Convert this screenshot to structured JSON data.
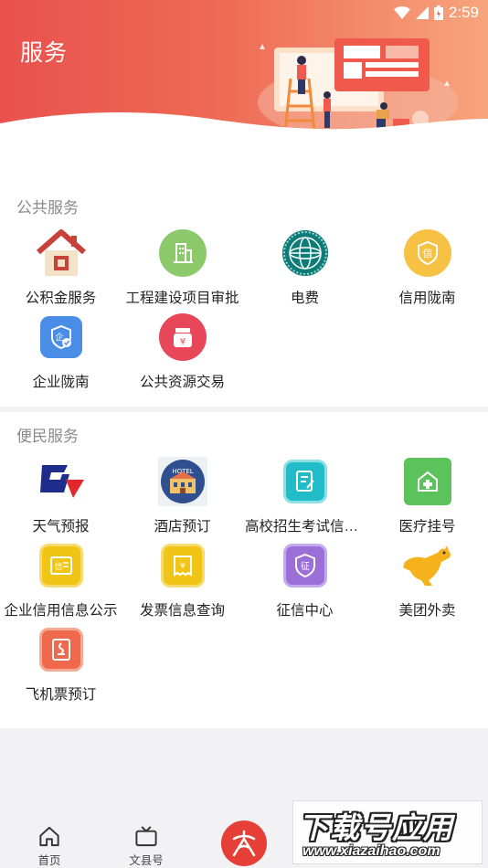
{
  "status_bar": {
    "time": "2:59"
  },
  "header": {
    "title": "服务"
  },
  "public_services": {
    "title": "公共服务",
    "items": [
      {
        "label": "公积金服务",
        "icon": "house-icon"
      },
      {
        "label": "工程建设项目审批",
        "icon": "building-icon"
      },
      {
        "label": "电费",
        "icon": "state-grid-logo-icon"
      },
      {
        "label": "信用陇南",
        "icon": "credit-badge-icon"
      },
      {
        "label": "企业陇南",
        "icon": "enterprise-shield-icon"
      },
      {
        "label": "公共资源交易",
        "icon": "yen-bag-icon"
      }
    ]
  },
  "convenience_services": {
    "title": "便民服务",
    "items": [
      {
        "label": "天气预报",
        "icon": "weather-logo-icon"
      },
      {
        "label": "酒店预订",
        "icon": "hotel-icon"
      },
      {
        "label": "高校招生考试信息查询",
        "icon": "exam-document-icon"
      },
      {
        "label": "医疗挂号",
        "icon": "hospital-icon"
      },
      {
        "label": "企业信用信息公示",
        "icon": "credit-info-icon"
      },
      {
        "label": "发票信息查询",
        "icon": "invoice-icon"
      },
      {
        "label": "征信中心",
        "icon": "credit-center-icon"
      },
      {
        "label": "美团外卖",
        "icon": "meituan-kangaroo-icon"
      },
      {
        "label": "飞机票预订",
        "icon": "flight-ticket-icon"
      }
    ]
  },
  "tab_bar": {
    "tabs": [
      {
        "label": "首页",
        "icon": "home-icon"
      },
      {
        "label": "文县号",
        "icon": "tv-icon"
      }
    ],
    "center_icon": "app-logo-icon"
  },
  "watermark": {
    "main": "下载号应用",
    "sub": "www.xiazaihao.com"
  },
  "colors": {
    "header_start": "#e9514d",
    "header_end": "#f7a57c",
    "accent": "#e53f37"
  }
}
